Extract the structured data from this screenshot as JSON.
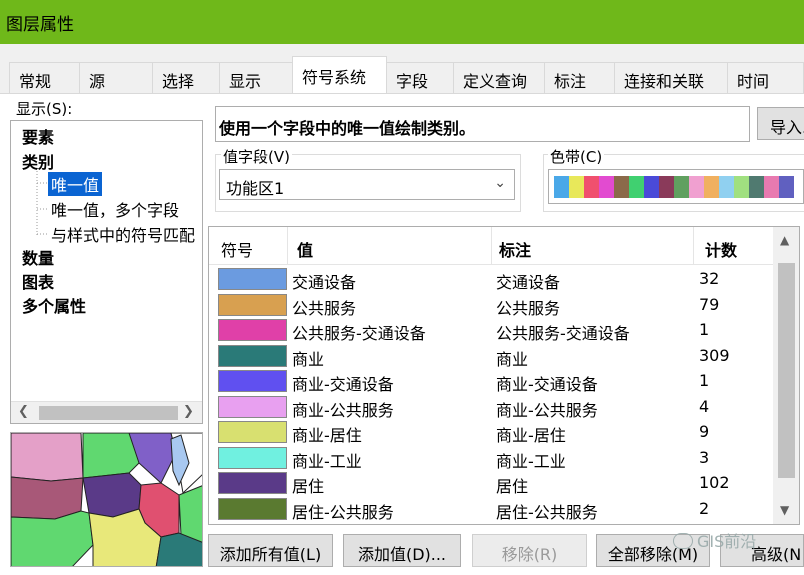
{
  "window": {
    "title": "图层属性",
    "title_bar_color": "#6fb81a"
  },
  "tabs": [
    {
      "label": "常规"
    },
    {
      "label": "源"
    },
    {
      "label": "选择"
    },
    {
      "label": "显示"
    },
    {
      "label": "符号系统",
      "active": true
    },
    {
      "label": "字段"
    },
    {
      "label": "定义查询"
    },
    {
      "label": "标注"
    },
    {
      "label": "连接和关联"
    },
    {
      "label": "时间"
    }
  ],
  "show_label": "显示(S):",
  "tree": {
    "items": [
      {
        "label": "要素",
        "bold": true
      },
      {
        "label": "类别",
        "bold": true
      },
      {
        "label": "唯一值",
        "selected": true
      },
      {
        "label": "唯一值，多个字段"
      },
      {
        "label": "与样式中的符号匹配"
      },
      {
        "label": "数量",
        "bold": true
      },
      {
        "label": "图表",
        "bold": true
      },
      {
        "label": "多个属性",
        "bold": true
      }
    ]
  },
  "description": "使用一个字段中的唯一值绘制类别。",
  "import_button": "导入...",
  "value_field": {
    "label": "值字段(V)",
    "value": "功能区1"
  },
  "color_ramp": {
    "label": "色带(C)",
    "colors": [
      "#4aa8e8",
      "#e8e85a",
      "#f0506e",
      "#e24bd0",
      "#8b6a4a",
      "#40d070",
      "#4a4ad8",
      "#8a3a5a",
      "#60a060",
      "#f0a0d0",
      "#f0b060",
      "#90d0f0",
      "#a0e080",
      "#507a70",
      "#e87ab0",
      "#6060c0"
    ]
  },
  "table": {
    "headers": {
      "symbol": "符号",
      "value": "值",
      "label": "标注",
      "count": "计数"
    },
    "rows": [
      {
        "color": "#6b9be0",
        "value": "交通设备",
        "label": "交通设备",
        "count": "32"
      },
      {
        "color": "#d8a050",
        "value": "公共服务",
        "label": "公共服务",
        "count": "79"
      },
      {
        "color": "#e040a8",
        "value": "公共服务-交通设备",
        "label": "公共服务-交通设备",
        "count": "1"
      },
      {
        "color": "#2a7a78",
        "value": "商业",
        "label": "商业",
        "count": "309"
      },
      {
        "color": "#6050f0",
        "value": "商业-交通设备",
        "label": "商业-交通设备",
        "count": "1"
      },
      {
        "color": "#e8a0f0",
        "value": "商业-公共服务",
        "label": "商业-公共服务",
        "count": "4"
      },
      {
        "color": "#d8e070",
        "value": "商业-居住",
        "label": "商业-居住",
        "count": "9"
      },
      {
        "color": "#70f0e0",
        "value": "商业-工业",
        "label": "商业-工业",
        "count": "3"
      },
      {
        "color": "#5a3a88",
        "value": "居住",
        "label": "居住",
        "count": "102"
      },
      {
        "color": "#5a7a30",
        "value": "居住-公共服务",
        "label": "居住-公共服务",
        "count": "2"
      }
    ]
  },
  "buttons": {
    "add_all": "添加所有值(L)",
    "add_value": "添加值(D)...",
    "remove": "移除(R)",
    "remove_all": "全部移除(M)",
    "advanced": "高级(N"
  },
  "watermark": "GIS前沿"
}
